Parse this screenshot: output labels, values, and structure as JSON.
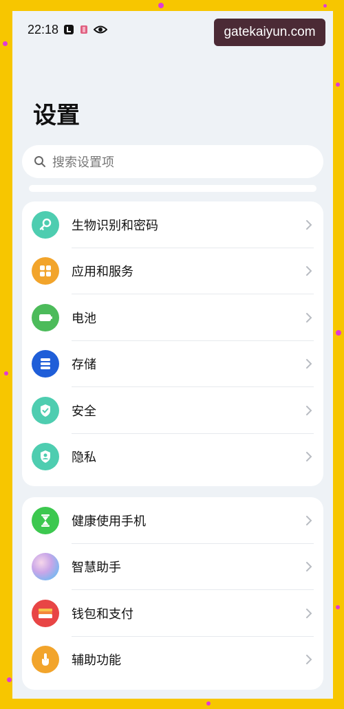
{
  "status_bar": {
    "time": "22:18",
    "icons": [
      "notification-l-icon",
      "app-icon",
      "eye-icon"
    ]
  },
  "watermark": {
    "text": "gatekaiyun.com"
  },
  "page": {
    "title": "设置"
  },
  "search": {
    "placeholder": "搜索设置项"
  },
  "groups": [
    {
      "items": [
        {
          "label": "生物识别和密码",
          "icon": "key-icon",
          "color": "#4ecdb0"
        },
        {
          "label": "应用和服务",
          "icon": "apps-grid-icon",
          "color": "#f2a42b"
        },
        {
          "label": "电池",
          "icon": "battery-icon",
          "color": "#4cbb5a"
        },
        {
          "label": "存储",
          "icon": "storage-icon",
          "color": "#1f5ed8"
        },
        {
          "label": "安全",
          "icon": "shield-check-icon",
          "color": "#4ecdb0"
        },
        {
          "label": "隐私",
          "icon": "privacy-icon",
          "color": "#4ecdb0"
        }
      ]
    },
    {
      "items": [
        {
          "label": "健康使用手机",
          "icon": "hourglass-icon",
          "color": "#3cc84f"
        },
        {
          "label": "智慧助手",
          "icon": "assistant-orb-icon",
          "color": "#c9a6e8"
        },
        {
          "label": "钱包和支付",
          "icon": "wallet-icon",
          "color": "#e84545"
        },
        {
          "label": "辅助功能",
          "icon": "hand-pointer-icon",
          "color": "#f2a42b"
        }
      ]
    }
  ]
}
